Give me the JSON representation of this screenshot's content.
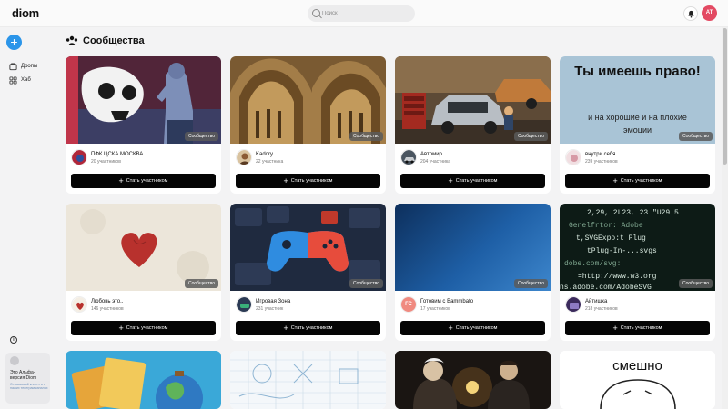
{
  "app": {
    "logo": "diom"
  },
  "search": {
    "placeholder": "Поиск"
  },
  "user": {
    "initials": "AT"
  },
  "sidebar": {
    "items": [
      {
        "label": "Дропы",
        "icon": "drops-icon"
      },
      {
        "label": "Хаб",
        "icon": "hub-icon"
      }
    ],
    "alpha": {
      "title": "Это Альфа-версия Diom",
      "text": "Отзывчивый клиент и в наших телеграм каналах"
    }
  },
  "page": {
    "title": "Сообщества",
    "title_icon": "communities-icon"
  },
  "badge_label": "Сообщество",
  "join_label": "Стать участником",
  "cards": [
    {
      "name": "ПФК ЦСКА МОСКВА",
      "members": "20 участников",
      "cover": "graffiti-skull"
    },
    {
      "name": "Kadory",
      "members": "22 участника",
      "cover": "cathedral-arch"
    },
    {
      "name": "Автомир",
      "members": "204 участника",
      "cover": "car-garage"
    },
    {
      "name": "внутри себя.",
      "members": "239 участников",
      "cover_text": "Ты имеешь право!",
      "cover_subtext": "и на хорошие и на плохие эмоции"
    },
    {
      "name": "Любовь это..",
      "members": "146 участников",
      "cover": "heart-paper"
    },
    {
      "name": "Игровая Зона",
      "members": "231 участник",
      "cover": "gamepad"
    },
    {
      "name": "Готовим с Bammbato",
      "members": "17 участников",
      "avatar_initials": "ГС",
      "cover": "blue-gradient"
    },
    {
      "name": "Айтишка",
      "members": "218 участников",
      "cover": "code-screen"
    },
    {
      "name": "",
      "members": "",
      "cover": "travel-globe"
    },
    {
      "name": "",
      "members": "",
      "cover": "sketch-paper"
    },
    {
      "name": "",
      "members": "",
      "cover": "scientists-bulb"
    },
    {
      "name": "",
      "members": "",
      "cover_text": "смешно",
      "cover": "meme-face"
    }
  ],
  "colors": {
    "accent": "#2b95e9",
    "avatar": "#e34a63",
    "button": "#050505"
  }
}
